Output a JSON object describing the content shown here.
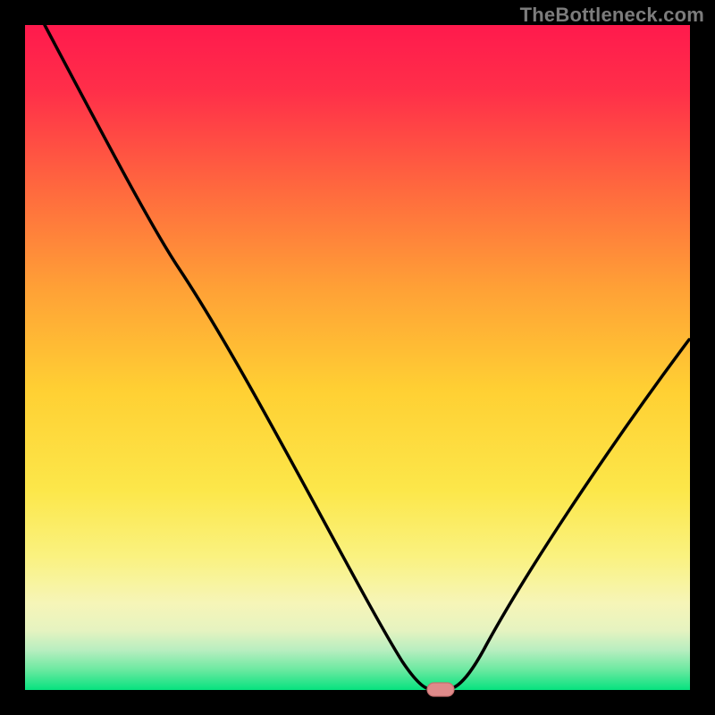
{
  "watermark": "TheBottleneck.com",
  "chart_data": {
    "type": "line",
    "title": "",
    "xlabel": "",
    "ylabel": "",
    "xlim": [
      0,
      100
    ],
    "ylim": [
      0,
      100
    ],
    "x": [
      3,
      10,
      20,
      30,
      40,
      50,
      55,
      58,
      60,
      62,
      65,
      70,
      80,
      90,
      100
    ],
    "values": [
      100,
      88,
      72,
      55,
      37,
      19,
      9,
      3,
      0,
      0,
      2,
      10,
      27,
      44,
      60
    ],
    "marker": {
      "x": 61,
      "y": 0,
      "color": "#e08a8a"
    },
    "background": "red-yellow-green-gradient",
    "annotations": []
  },
  "colors": {
    "frame": "#000000",
    "curve": "#000000",
    "marker_fill": "#df8a8a",
    "gradient_top": "#ff1a4a",
    "gradient_mid_upper": "#ff8a3a",
    "gradient_mid": "#ffd933",
    "gradient_mid_lower": "#f6f48a",
    "gradient_green_1": "#c6eda0",
    "gradient_bottom": "#06e27f"
  }
}
